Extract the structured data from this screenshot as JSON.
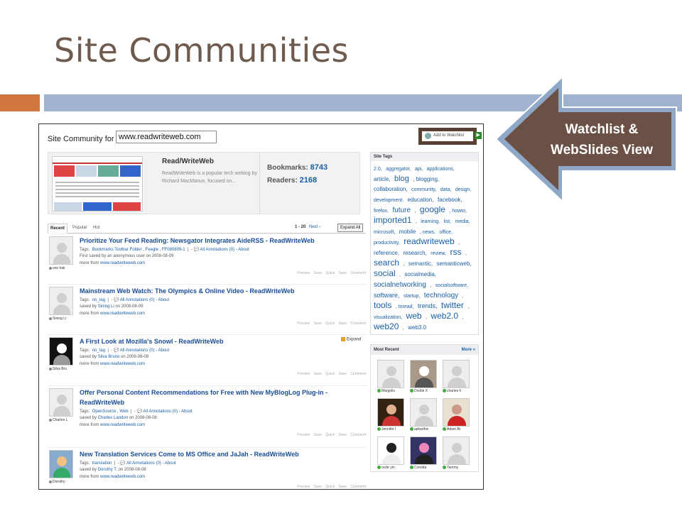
{
  "slide": {
    "title": "Site Communities",
    "colors": {
      "title": "#6f5b4e",
      "bar_left": "#d2763f",
      "bar_right": "#9fb3cf",
      "callout_fill": "#6b5145",
      "callout_border": "#8fa8c8"
    }
  },
  "callout": {
    "line1": "Watchlist &",
    "line2": "WebSlides View"
  },
  "site_community": {
    "label": "Site Community for",
    "url_value": "www.readwriteweb.com",
    "watchlist_label": "Add to Watchlist",
    "site_name": "Read/WriteWeb",
    "site_description": "ReadWriteWeb is a popular tech weblog by Richard MacManus, focused on...",
    "bookmarks_label": "Bookmarks:",
    "bookmarks_count": "8743",
    "readers_label": "Readers:",
    "readers_count": "2168"
  },
  "tabs": [
    "Recent",
    "Popular",
    "Hot"
  ],
  "pager": {
    "range": "1 - 20",
    "next": "Next ›",
    "expand_all": "Expand All"
  },
  "entries": [
    {
      "title": "Prioritize Your Feed Reading: Newsgator Integrates AideRSS - ReadWriteWeb",
      "tags_label": "Tags:",
      "tags": "Bookmarks Toolbar Folder ,  Feegle ,  FF080809-1",
      "annotations": "All Annotations (0)",
      "about": "About",
      "saved": "First saved by an anonymous user on 2008-08-09",
      "more": "more from",
      "more_link": "www.readwriteweb.com",
      "user": "vee hak",
      "actions": "Preview Save Quick Save Comment"
    },
    {
      "title": "Mainstream Web Watch: The Olympics & Online Video - ReadWriteWeb",
      "tags_label": "Tags:",
      "tags": "no_tag",
      "annotations": "All Annotations (0)",
      "about": "About",
      "saved_prefix": "saved by",
      "saved_user": "Sining Li",
      "saved_date": "on 2008-08-09",
      "more": "more from",
      "more_link": "www.readwriteweb.com",
      "user": "Sining Li",
      "actions": "Preview Save Quick Save Comment"
    },
    {
      "title": "A First Look at Mozilla's Snowl - ReadWriteWeb",
      "tags_label": "Tags:",
      "tags": "no_tag",
      "annotations": "All Annotations (0)",
      "about": "About",
      "saved_prefix": "saved by",
      "saved_user": "Silva Bruno",
      "saved_date": "on 2008-08-08",
      "more": "more from",
      "more_link": "www.readwriteweb.com",
      "user": "Silva Bru",
      "expand": "Expand",
      "actions": "Preview Save Quick Save Comment"
    },
    {
      "title": "Offer Personal Content Recommendations for Free with New MyBlogLog Plug-in - ReadWriteWeb",
      "tags_label": "Tags:",
      "tags": "OpenSource ,  Web",
      "annotations": "All Annotations (0)",
      "about": "About",
      "saved_prefix": "saved by",
      "saved_user": "Charles Landon",
      "saved_date": "on 2008-08-08",
      "more": "more from",
      "more_link": "www.readwriteweb.com",
      "user": "Charles L",
      "actions": "Preview Save Quick Save Comment"
    },
    {
      "title": "New Translation Services Come to MS Office and JaJah - ReadWriteWeb",
      "tags_label": "Tags:",
      "tags": "translation",
      "annotations": "All Annotations (0)",
      "about": "About",
      "saved_prefix": "saved by",
      "saved_user": "Dorothy T.",
      "saved_date": "on 2008-08-08",
      "more": "more from",
      "more_link": "www.readwriteweb.com",
      "user": "Dorothy",
      "actions": "Preview Save Quick Save Comment"
    }
  ],
  "site_tags": {
    "header": "Site Tags",
    "tags": [
      {
        "t": "2.0,",
        "s": 7
      },
      {
        "t": "aggregator,",
        "s": 7
      },
      {
        "t": "api,",
        "s": 7
      },
      {
        "t": "applications,",
        "s": 7
      },
      {
        "t": "article,",
        "s": 8
      },
      {
        "t": "blog",
        "s": 11
      },
      {
        "t": ", blogging,",
        "s": 8
      },
      {
        "t": "collaboration,",
        "s": 8
      },
      {
        "t": "community,",
        "s": 7
      },
      {
        "t": "data,",
        "s": 7
      },
      {
        "t": "design,",
        "s": 7
      },
      {
        "t": "development,",
        "s": 7
      },
      {
        "t": "education,",
        "s": 8
      },
      {
        "t": "facebook,",
        "s": 8
      },
      {
        "t": "firefox,",
        "s": 7
      },
      {
        "t": "future",
        "s": 10
      },
      {
        "t": ",",
        "s": 7
      },
      {
        "t": "google",
        "s": 12
      },
      {
        "t": ", howto,",
        "s": 7
      },
      {
        "t": "imported1",
        "s": 12
      },
      {
        "t": ",",
        "s": 7
      },
      {
        "t": "learning,",
        "s": 7
      },
      {
        "t": "list,",
        "s": 7
      },
      {
        "t": "media,",
        "s": 7
      },
      {
        "t": "microsoft,",
        "s": 7
      },
      {
        "t": "mobile",
        "s": 8
      },
      {
        "t": ", news,",
        "s": 7
      },
      {
        "t": "office,",
        "s": 7
      },
      {
        "t": "productivity,",
        "s": 7
      },
      {
        "t": "readwriteweb",
        "s": 12
      },
      {
        "t": ", reference,",
        "s": 8
      },
      {
        "t": "research,",
        "s": 8
      },
      {
        "t": "review,",
        "s": 7
      },
      {
        "t": "rss",
        "s": 12
      },
      {
        "t": ",",
        "s": 7
      },
      {
        "t": "search",
        "s": 12
      },
      {
        "t": ",",
        "s": 7
      },
      {
        "t": "semantic,",
        "s": 8
      },
      {
        "t": "semanticweb,",
        "s": 8
      },
      {
        "t": "social",
        "s": 12
      },
      {
        "t": ",",
        "s": 7
      },
      {
        "t": "socialmedia,",
        "s": 8
      },
      {
        "t": "socialnetworking",
        "s": 10
      },
      {
        "t": ",",
        "s": 7
      },
      {
        "t": "socialsoftware,",
        "s": 7
      },
      {
        "t": "software,",
        "s": 9
      },
      {
        "t": "startup,",
        "s": 7
      },
      {
        "t": "technology",
        "s": 10
      },
      {
        "t": ",",
        "s": 7
      },
      {
        "t": "tools",
        "s": 12
      },
      {
        "t": ", toread,",
        "s": 7
      },
      {
        "t": "trends,",
        "s": 9
      },
      {
        "t": "twitter",
        "s": 12
      },
      {
        "t": ", visualization,",
        "s": 7
      },
      {
        "t": "web",
        "s": 12
      },
      {
        "t": ",",
        "s": 7
      },
      {
        "t": "web2.0",
        "s": 12
      },
      {
        "t": ",",
        "s": 7
      },
      {
        "t": "web20",
        "s": 12
      },
      {
        "t": ",",
        "s": 7
      },
      {
        "t": "web3.0",
        "s": 8
      }
    ]
  },
  "most_recent": {
    "header": "Most Recent",
    "more": "More »",
    "users": [
      "Margolis",
      "Doobii X",
      "charles h",
      "Jennifer I",
      "apkarthic",
      "Adam Br",
      "ocde yin",
      "Corvida",
      "Tammy"
    ]
  }
}
